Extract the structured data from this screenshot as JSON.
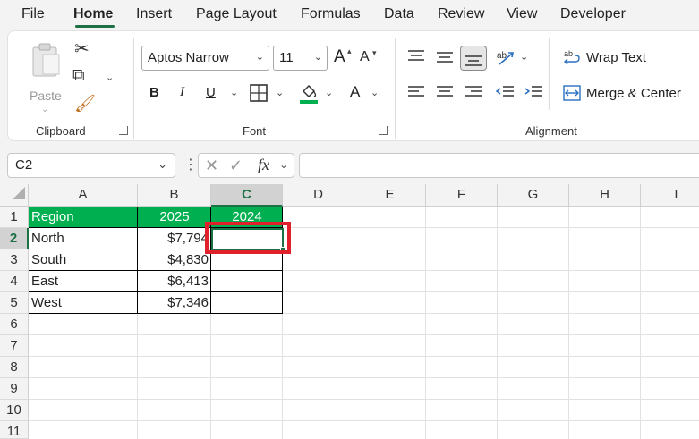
{
  "menu": {
    "items": [
      "File",
      "Home",
      "Insert",
      "Page Layout",
      "Formulas",
      "Data",
      "Review",
      "View",
      "Developer"
    ],
    "active": "Home"
  },
  "ribbon": {
    "clipboard": {
      "label": "Clipboard",
      "paste": "Paste"
    },
    "font": {
      "label": "Font",
      "name": "Aptos Narrow",
      "size": "11",
      "bold": "B",
      "italic": "I",
      "underline": "U",
      "grow": "A",
      "color": "A"
    },
    "alignment": {
      "label": "Alignment",
      "wrap_text": "Wrap Text",
      "merge_center": "Merge & Center"
    }
  },
  "formula_bar": {
    "name_box": "C2",
    "fx": "fx",
    "formula": ""
  },
  "sheet": {
    "columns": [
      "A",
      "B",
      "C",
      "D",
      "E",
      "F",
      "G",
      "H",
      "I"
    ],
    "rows": [
      "1",
      "2",
      "3",
      "4",
      "5",
      "6",
      "7",
      "8",
      "9",
      "10",
      "11"
    ],
    "selected_col": "C",
    "selected_row": "2",
    "header": [
      "Region",
      "2025",
      "2024"
    ],
    "data": [
      [
        "North",
        "$7,794",
        ""
      ],
      [
        "South",
        "$4,830",
        ""
      ],
      [
        "East",
        "$6,413",
        ""
      ],
      [
        "West",
        "$7,346",
        ""
      ]
    ],
    "header_color": "#00b050",
    "highlight_color": "#e0202a"
  }
}
